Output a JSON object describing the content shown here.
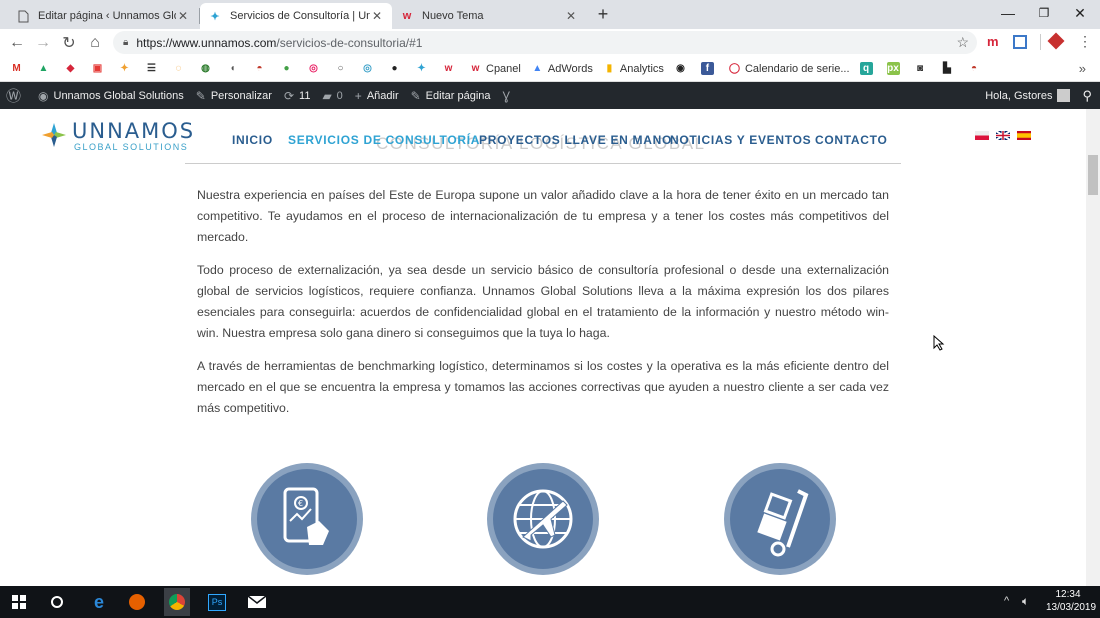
{
  "browser": {
    "tabs": [
      {
        "title": "Editar página ‹ Unnamos Global S",
        "icon": "document-icon",
        "active": false
      },
      {
        "title": "Servicios de Consultoría | Unnam",
        "icon": "unnamos-favicon",
        "active": true
      },
      {
        "title": "Nuevo Tema",
        "icon": "w-favicon",
        "active": false
      }
    ],
    "new_tab": "+",
    "url_host": "https://www.unnamos.com",
    "url_path": "/servicios-de-consultoria/#1"
  },
  "bookmarks": {
    "items": [
      {
        "label": "",
        "icon": "gmail-icon"
      },
      {
        "label": "",
        "icon": "drive-icon"
      },
      {
        "label": "",
        "icon": "red-diamond-icon"
      },
      {
        "label": "",
        "icon": "red-badge-icon"
      },
      {
        "label": "",
        "icon": "star-icon"
      },
      {
        "label": "",
        "icon": "stack-icon"
      },
      {
        "label": "",
        "icon": "orange-circle-icon"
      },
      {
        "label": "",
        "icon": "globe-icon"
      },
      {
        "label": "",
        "icon": "bird-icon"
      },
      {
        "label": "",
        "icon": "bell-icon"
      },
      {
        "label": "",
        "icon": "green-dot-icon"
      },
      {
        "label": "",
        "icon": "pink-circle-icon"
      },
      {
        "label": "",
        "icon": "empty-circle-icon"
      },
      {
        "label": "",
        "icon": "blue-circle-icon"
      },
      {
        "label": "",
        "icon": "black-circle-icon"
      },
      {
        "label": "",
        "icon": "unnamos-icon"
      },
      {
        "label": "",
        "icon": "w-icon"
      },
      {
        "label": "Cpanel",
        "icon": "w-icon"
      },
      {
        "label": "AdWords",
        "icon": "adwords-icon"
      },
      {
        "label": "Analytics",
        "icon": "analytics-icon"
      },
      {
        "label": "",
        "icon": "tripadvisor-icon"
      },
      {
        "label": "",
        "icon": "facebook-icon"
      },
      {
        "label": "Calendario de serie...",
        "icon": "calendar-icon"
      },
      {
        "label": "",
        "icon": "q-icon"
      },
      {
        "label": "",
        "icon": "px-icon"
      },
      {
        "label": "",
        "icon": "camera-icon"
      },
      {
        "label": "",
        "icon": "upload-icon"
      },
      {
        "label": "",
        "icon": "red-bell-icon"
      }
    ],
    "more": "»"
  },
  "wpbar": {
    "site": "Unnamos Global Solutions",
    "customize": "Personalizar",
    "updates": "11",
    "comments": "0",
    "add": "Añadir",
    "edit": "Editar página",
    "greeting": "Hola, Gstores"
  },
  "site": {
    "logo_name": "UNNAMOS",
    "logo_sub": "GLOBAL SOLUTIONS",
    "nav": [
      {
        "label": "INICIO",
        "active": false
      },
      {
        "label": "SERVICIOS DE CONSULTORÍA",
        "active": true
      },
      {
        "label": "PROYECTOS LLAVE EN MANO",
        "active": false
      },
      {
        "label": "NOTICIAS Y EVENTOS",
        "active": false
      },
      {
        "label": "CONTACTO",
        "active": false
      }
    ],
    "ghost_title": "CONSULTORÍA LOGÍSTICA GLOBAL",
    "paragraphs": [
      "Nuestra experiencia en países del Este de Europa supone un valor añadido clave a la hora de tener éxito en un mercado tan competitivo. Te ayudamos en el proceso de internacionalización de tu empresa y a tener los costes más competitivos del mercado.",
      "Todo proceso de externalización, ya sea desde un servicio básico de consultoría profesional o desde una externalización global de servicios logísticos, requiere confianza. Unnamos Global Solutions lleva a la máxima expresión los dos pilares esenciales para conseguirla: acuerdos de confidencialidad global en el tratamiento de la información y nuestro método win-win. Nuestra empresa solo gana dinero si conseguimos que la tuya lo haga.",
      "A través de herramientas de benchmarking logístico, determinamos si los costes y la operativa es la más eficiente dentro del mercado en el que se encuentra la empresa y tomamos las acciones correctivas que ayuden a nuestro cliente a ser cada vez más competitivo."
    ],
    "service_icons": [
      "tablet-finance-icon",
      "globe-plane-icon",
      "hand-truck-icon"
    ]
  },
  "taskbar": {
    "time": "12:34",
    "date": "13/03/2019"
  },
  "colors": {
    "nav": "#2a5d8f",
    "nav_active": "#2fa3d3",
    "wpbar": "#23282d",
    "circle_outer": "#8aa2bf",
    "circle_inner": "#5a7aa3"
  }
}
